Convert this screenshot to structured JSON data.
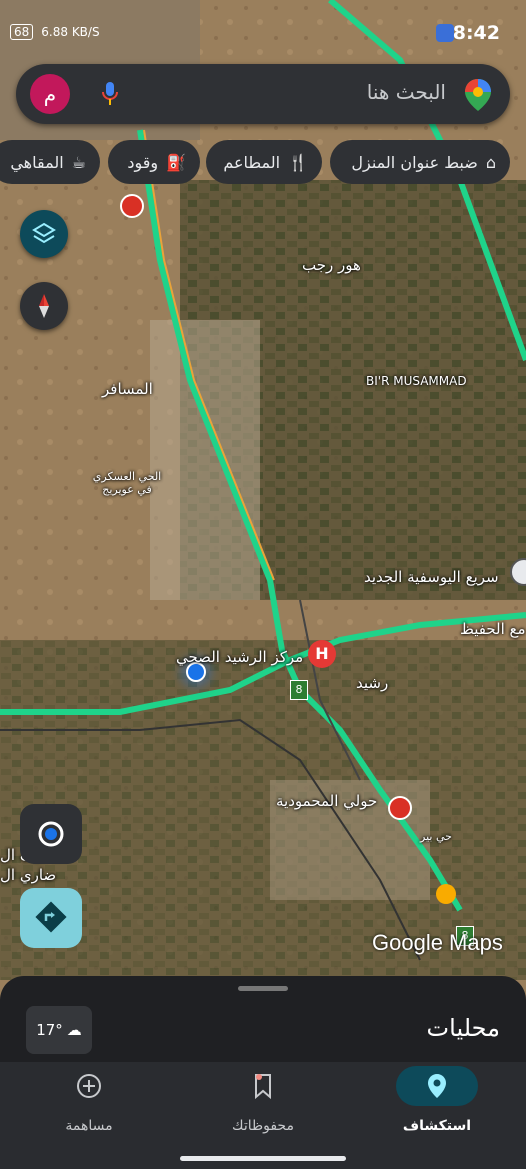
{
  "status_bar": {
    "time": "8:42",
    "battery_chip": "68",
    "network_speed": "6.88 KB/S"
  },
  "search": {
    "placeholder": "البحث هنا",
    "avatar_letter": "م"
  },
  "chips": [
    {
      "label": "ضبط عنوان المنزل",
      "icon": "home-icon"
    },
    {
      "label": "المطاعم",
      "icon": "restaurant-icon"
    },
    {
      "label": "وقود",
      "icon": "fuel-icon"
    },
    {
      "label": "المقاهي",
      "icon": "coffee-icon"
    }
  ],
  "map_labels": {
    "hor_rajab": "هور رجب",
    "bir_musammad": "BI'R MUSAMMAD",
    "almusafer": "المسافر",
    "military": "الحي العسكري في عويريج",
    "yusufiya": "سريع اليوسفية الجديد",
    "hafeedh": "مع الحفيظ",
    "health_center": "مركز الرشيد الصحي",
    "rasheed": "رشيد",
    "mahmoudiya": "حولي المحمودية",
    "hay_ber": "حي بير",
    "left_cut1": "يف ال",
    "left_cut2": "ضاري ال",
    "route_8a": "8",
    "route_8b": "8",
    "watermark": "Google Maps"
  },
  "bottom_sheet": {
    "title": "محليات",
    "weather_temp": "17°"
  },
  "bottom_nav": [
    {
      "label": "مساهمة",
      "icon": "add-circle-icon",
      "active": false
    },
    {
      "label": "محفوظاتك",
      "icon": "bookmark-icon",
      "active": false
    },
    {
      "label": "استكشاف",
      "icon": "location-pin-icon",
      "active": true
    }
  ],
  "colors": {
    "traffic_green": "#1fd38a",
    "accent_blue": "#1a73e8",
    "active_pill": "#0d4a5a",
    "avatar": "#c2185b"
  }
}
